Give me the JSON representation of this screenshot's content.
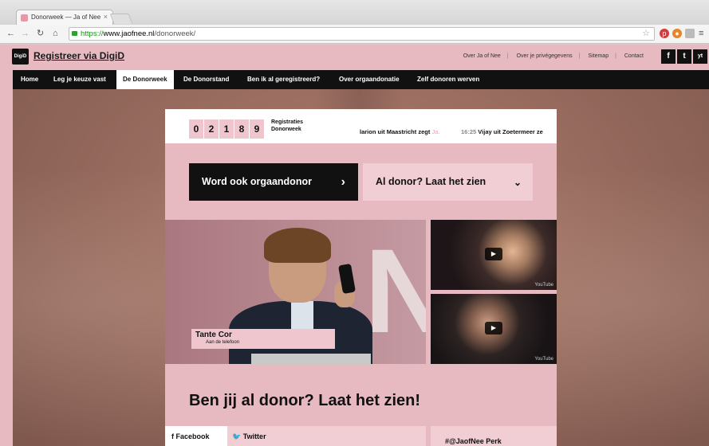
{
  "browser": {
    "tab_title": "Donorweek — Ja of Nee",
    "tab_close": "×",
    "url_scheme": "https://",
    "url_domain": "www.jaofnee.nl",
    "url_path": "/donorweek/",
    "star_icon": "☆"
  },
  "header": {
    "digid_logo": "DigiD",
    "digid_link": "Registreer via DigiD",
    "top_links": [
      "Over Ja of Nee",
      "Over je privégegevens",
      "Sitemap",
      "Contact"
    ],
    "social": [
      "f",
      "t",
      "yt"
    ]
  },
  "nav": {
    "items": [
      "Home",
      "Leg je keuze vast",
      "De Donorweek",
      "De Donorstand",
      "Ben ik al geregistreerd?",
      "Over orgaandonatie",
      "Zelf donoren werven"
    ],
    "active": "De Donorweek"
  },
  "counter": {
    "digits": [
      "0",
      "2",
      "1",
      "8",
      "9"
    ],
    "label_line1": "Registraties",
    "label_line2": "Donorweek"
  },
  "ticker": {
    "item1_text": "larion uit Maastricht zegt",
    "item1_answer": "Ja.",
    "item2_time": "16:25",
    "item2_text": "Vijay uit Zoetermeer ze"
  },
  "cta": {
    "primary": "Word ook orgaandonor",
    "primary_chevron": "›",
    "secondary": "Al donor? Laat het zien",
    "secondary_chevron": "⌄"
  },
  "video": {
    "name": "Tante Cor",
    "role": "Aan de telefoon",
    "bg_letter": "N"
  },
  "thumbs": {
    "play": "▶",
    "yt_label": "YouTube"
  },
  "main": {
    "headline": "Ben jij al donor? Laat het zien!"
  },
  "share": {
    "facebook": "Facebook",
    "twitter": "Twitter",
    "hashtag": "#@JaofNee Perk"
  }
}
